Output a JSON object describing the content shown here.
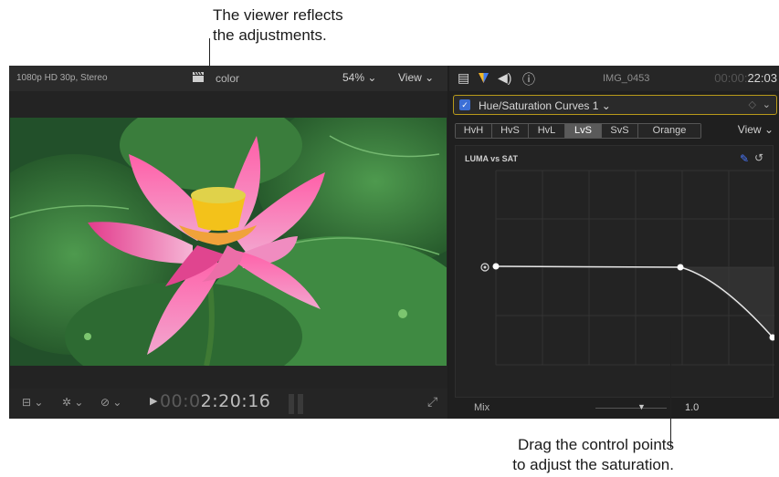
{
  "callouts": {
    "top_line1": "The viewer reflects",
    "top_line2": "the adjustments.",
    "bottom_line1": "Drag the control points",
    "bottom_line2": "to adjust the saturation."
  },
  "viewer": {
    "format": "1080p HD 30p, Stereo",
    "clip_label": "color",
    "zoom": "54%",
    "view_menu": "View",
    "timecode_dim": "00:0",
    "timecode_main": "2:20:16"
  },
  "inspector": {
    "clip_name": "IMG_0453",
    "timecode_dim": "00:00:",
    "timecode_main": "22:03",
    "effect_name": "Hue/Saturation Curves 1",
    "tabs": [
      "HvH",
      "HvS",
      "HvL",
      "LvS",
      "SvS",
      "Orange"
    ],
    "active_tab": "LvS",
    "view_menu": "View",
    "curve_title": "LUMA vs SAT",
    "mix_label": "Mix",
    "mix_value": "1.0"
  },
  "colors": {
    "accent_blue": "#3c6fd6",
    "selection_yellow": "#b89a1a"
  },
  "icons": [
    "clapper-icon",
    "chevron-down-icon",
    "film-icon",
    "color-icon",
    "audio-icon",
    "info-icon",
    "eyedropper-icon",
    "reset-icon",
    "fullscreen-icon",
    "play-icon"
  ]
}
